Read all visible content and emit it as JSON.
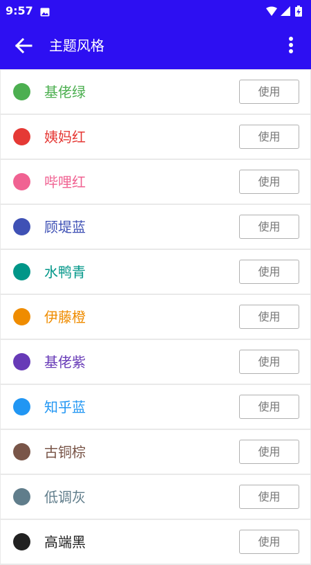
{
  "status_bar": {
    "time": "9:57",
    "icons": [
      "gallery-icon",
      "wifi-icon",
      "signal-icon",
      "battery-charging-icon"
    ]
  },
  "app_bar": {
    "title": "主题风格",
    "back_icon": "arrow-left-icon",
    "menu_icon": "more-vertical-icon",
    "background": "#2d0ff2"
  },
  "themes": [
    {
      "name": "基佬绿",
      "color": "#4caf50",
      "button": "使用"
    },
    {
      "name": "姨妈红",
      "color": "#e53935",
      "button": "使用"
    },
    {
      "name": "哔哩红",
      "color": "#f06292",
      "button": "使用"
    },
    {
      "name": "顾堤蓝",
      "color": "#3f51b5",
      "button": "使用"
    },
    {
      "name": "水鸭青",
      "color": "#009688",
      "button": "使用"
    },
    {
      "name": "伊藤橙",
      "color": "#ef8c00",
      "button": "使用"
    },
    {
      "name": "基佬紫",
      "color": "#673ab7",
      "button": "使用"
    },
    {
      "name": "知乎蓝",
      "color": "#2196f3",
      "button": "使用"
    },
    {
      "name": "古铜棕",
      "color": "#795548",
      "button": "使用"
    },
    {
      "name": "低调灰",
      "color": "#607d8b",
      "button": "使用"
    },
    {
      "name": "高端黑",
      "color": "#212121",
      "button": "使用"
    }
  ]
}
